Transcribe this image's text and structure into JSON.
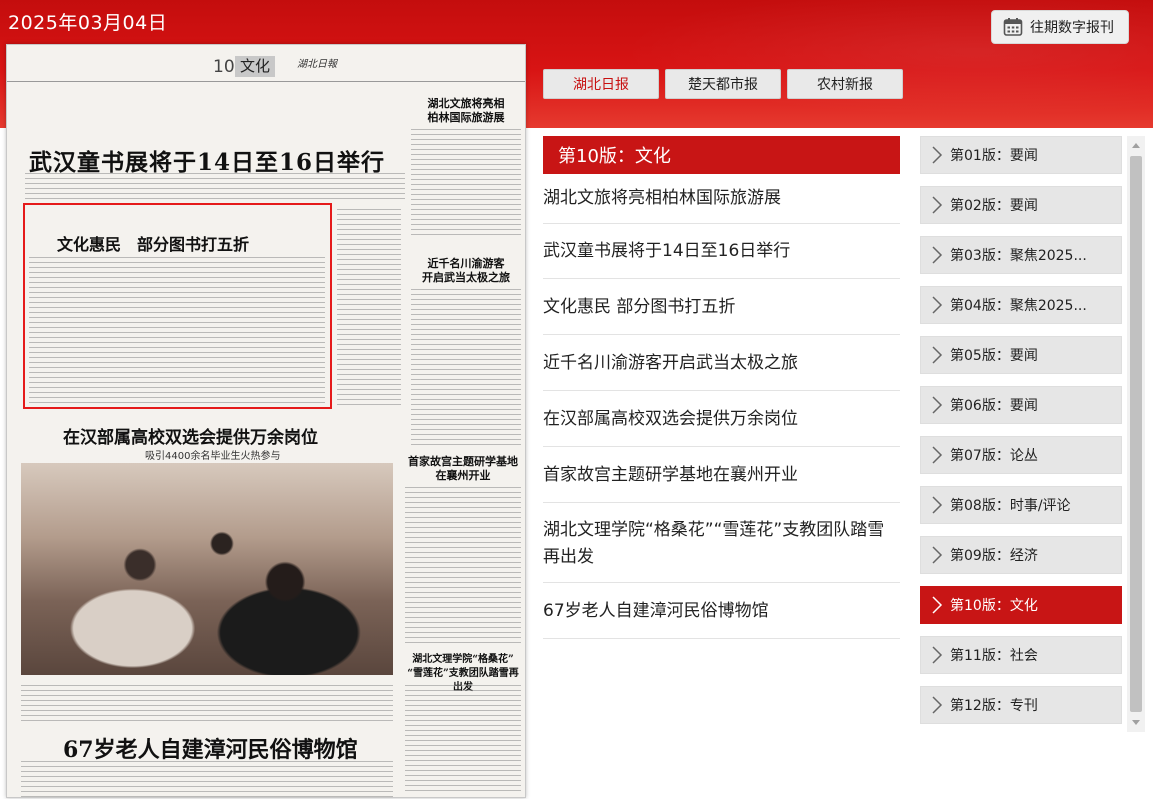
{
  "header": {
    "date": "2025年03月04日",
    "archive_button": "往期数字报刊",
    "paper_tabs": [
      {
        "label": "湖北日报",
        "active": true
      },
      {
        "label": "楚天都市报",
        "active": false
      },
      {
        "label": "农村新报",
        "active": false
      }
    ]
  },
  "newspaper": {
    "page_number": "10",
    "section": "文化",
    "masthead": "湖北日報",
    "headline_main": "武汉童书展将于14日至16日举行",
    "headline_side1": "湖北文旅将亮相\n柏林国际旅游展",
    "headline_boxed": "文化惠民　部分图书打五折",
    "headline_side2": "近千名川渝游客\n开启武当太极之旅",
    "headline_jobs": "在汉部属高校双选会提供万余岗位",
    "subhead_jobs": "吸引4400余名毕业生火热参与",
    "headline_side3": "首家故宫主题研学基地\n在襄州开业",
    "headline_side4": "湖北文理学院“格桑花”\n“雪莲花”支教团队踏雪再出发",
    "headline_bottom": "67岁老人自建漳河民俗博物馆"
  },
  "section_bar": "第10版：文化",
  "articles": [
    "湖北文旅将亮相柏林国际旅游展",
    "武汉童书展将于14日至16日举行",
    "文化惠民 部分图书打五折",
    "近千名川渝游客开启武当太极之旅",
    "在汉部属高校双选会提供万余岗位",
    "首家故宫主题研学基地在襄州开业",
    "湖北文理学院“格桑花”“雪莲花”支教团队踏雪再出发",
    "67岁老人自建漳河民俗博物馆"
  ],
  "pages": [
    {
      "label": "第01版：要闻",
      "active": false
    },
    {
      "label": "第02版：要闻",
      "active": false
    },
    {
      "label": "第03版：聚焦2025...",
      "active": false
    },
    {
      "label": "第04版：聚焦2025...",
      "active": false
    },
    {
      "label": "第05版：要闻",
      "active": false
    },
    {
      "label": "第06版：要闻",
      "active": false
    },
    {
      "label": "第07版：论丛",
      "active": false
    },
    {
      "label": "第08版：时事/评论",
      "active": false
    },
    {
      "label": "第09版：经济",
      "active": false
    },
    {
      "label": "第10版：文化",
      "active": true
    },
    {
      "label": "第11版：社会",
      "active": false
    },
    {
      "label": "第12版：专刊",
      "active": false
    }
  ],
  "colors": {
    "brand_red": "#c81515",
    "highlight_box": "#e51a1a"
  }
}
